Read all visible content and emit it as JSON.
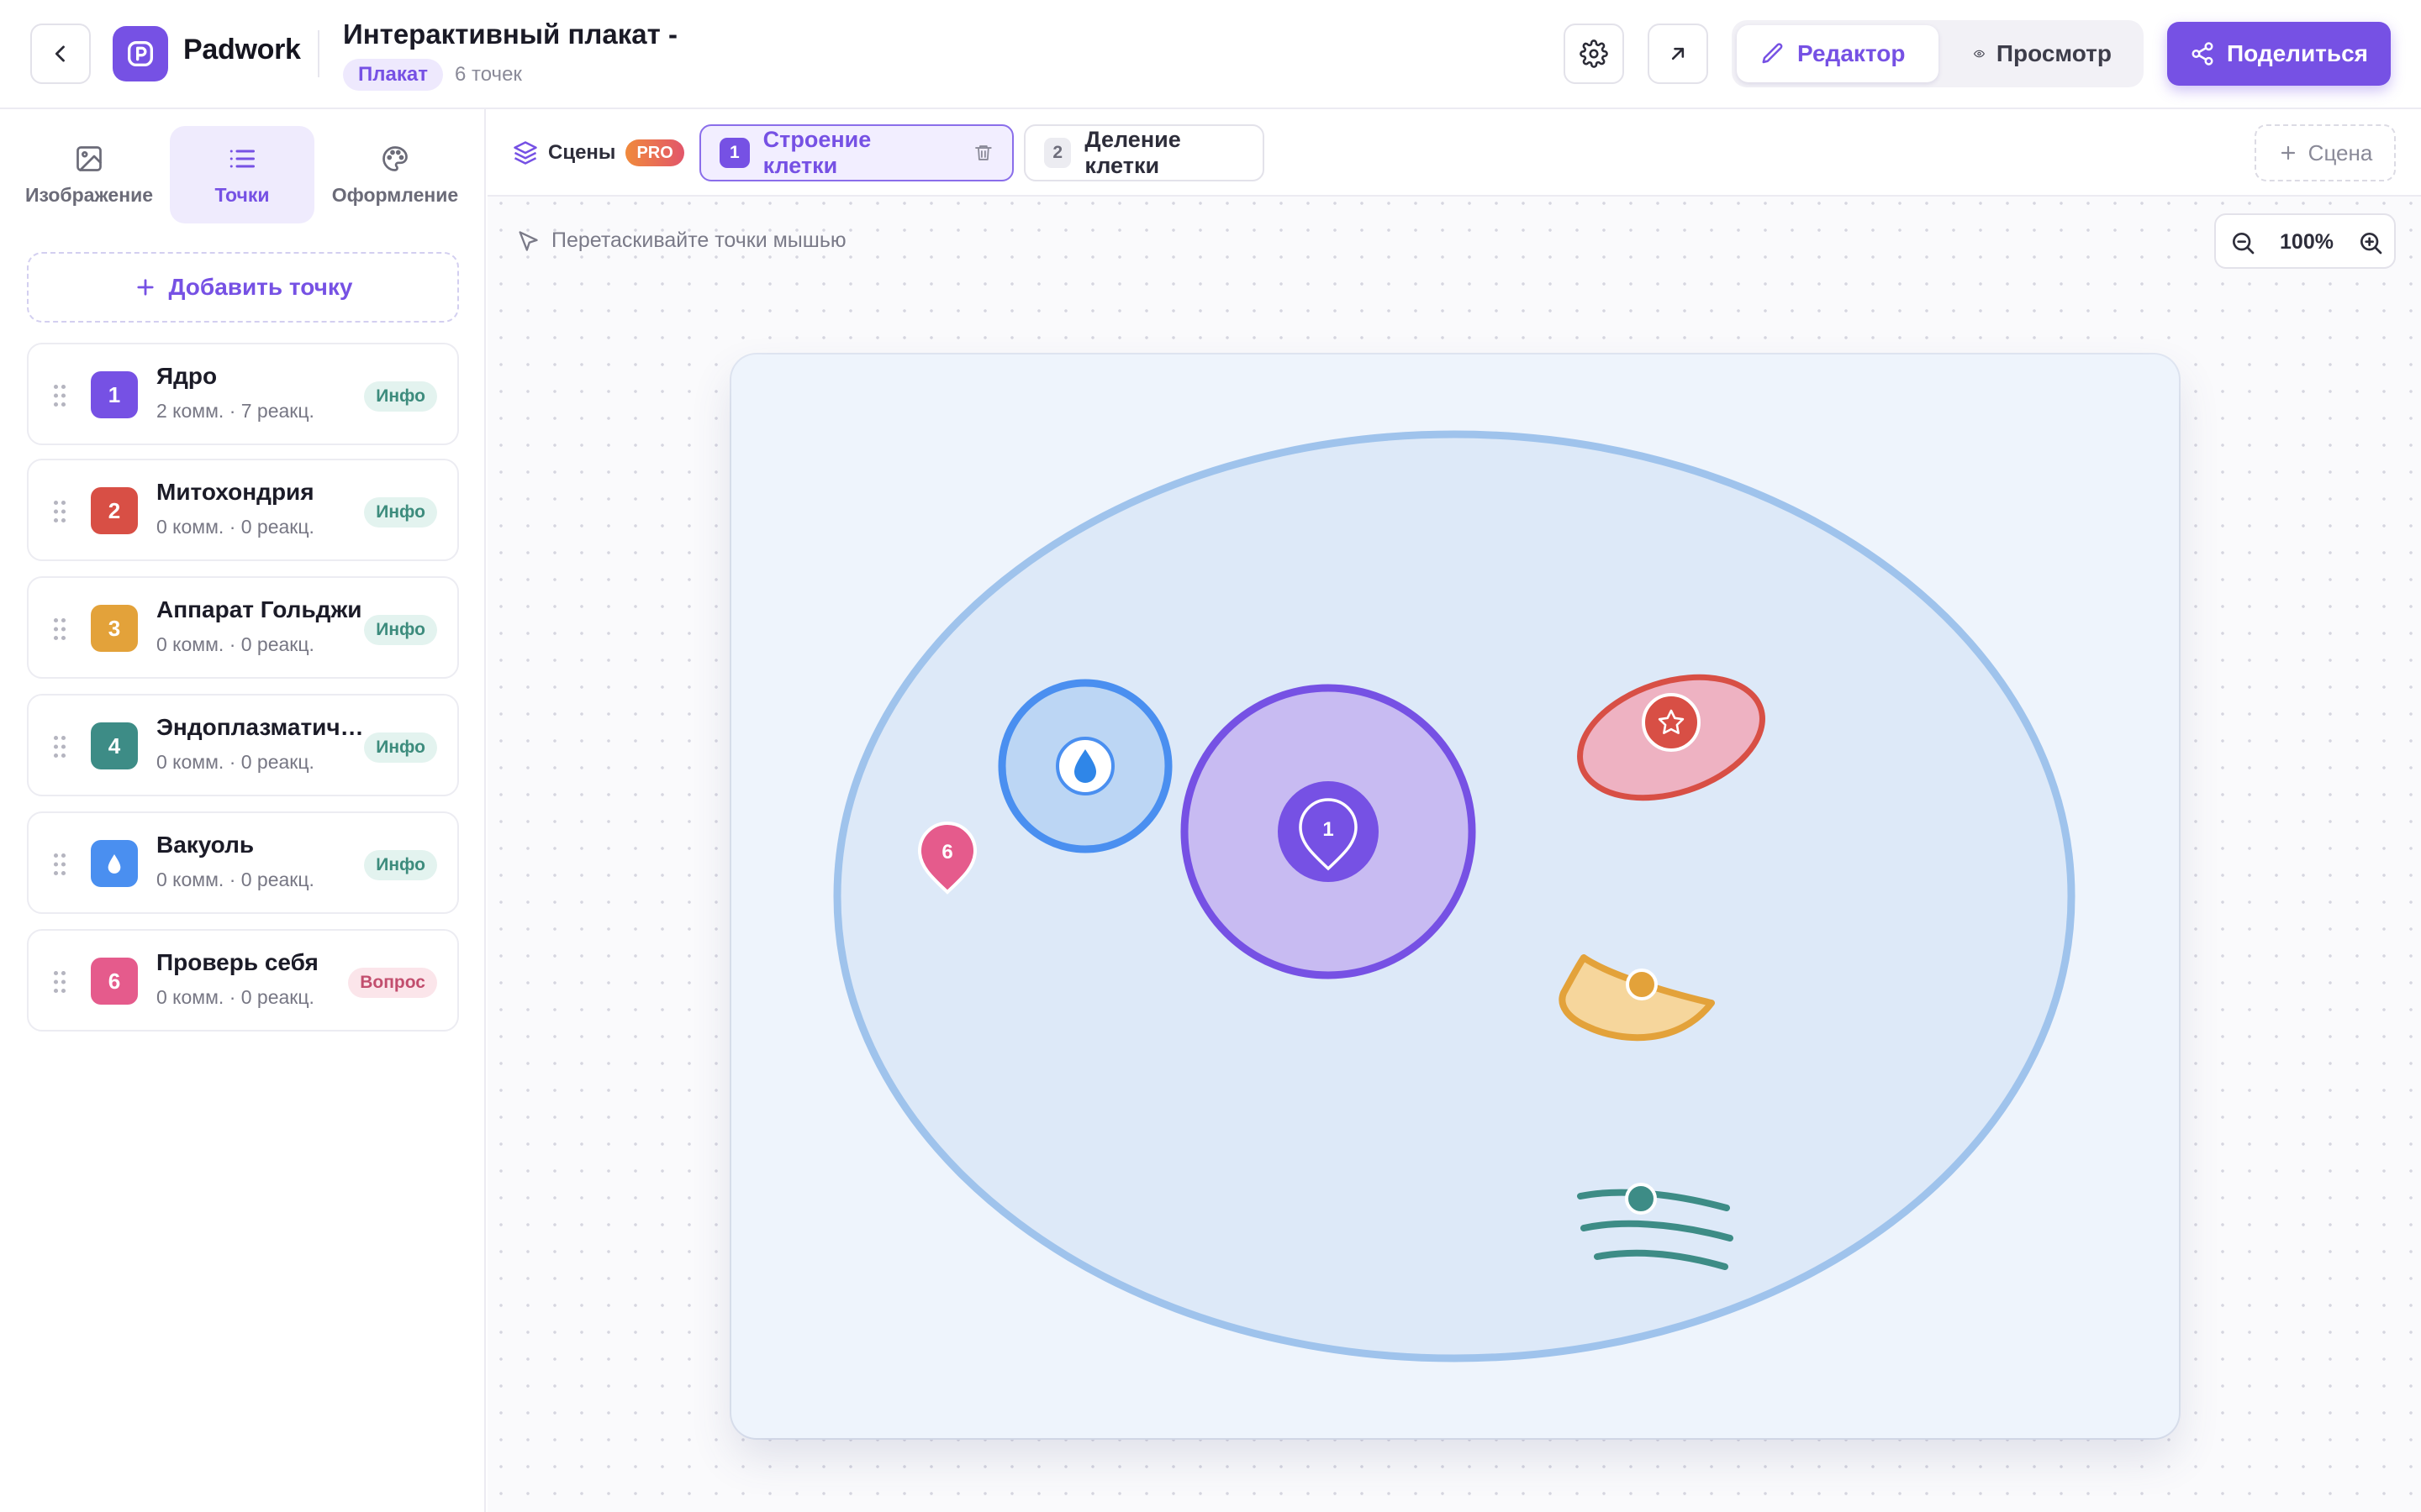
{
  "header": {
    "app_name": "Padwork",
    "doc_title": "Интерактивный плакат -",
    "doc_type": "Плакат",
    "doc_meta": "6 точек",
    "mode_editor": "Редактор",
    "mode_preview": "Просмотр",
    "share_label": "Поделиться"
  },
  "sidebar": {
    "tabs": [
      {
        "label": "Изображение",
        "icon": "image-icon",
        "active": false
      },
      {
        "label": "Точки",
        "icon": "list-icon",
        "active": true
      },
      {
        "label": "Оформление",
        "icon": "palette-icon",
        "active": false
      }
    ],
    "add_point_label": "Добавить точку",
    "points": [
      {
        "num": "1",
        "title": "Ядро",
        "stats": "2 комм. · 7 реакц.",
        "badge": "Инфо",
        "badge_type": "info",
        "color": "#7651e4"
      },
      {
        "num": "2",
        "title": "Митохондрия",
        "stats": "0 комм. · 0 реакц.",
        "badge": "Инфо",
        "badge_type": "info",
        "color": "#d84f45"
      },
      {
        "num": "3",
        "title": "Аппарат Гольджи",
        "stats": "0 комм. · 0 реакц.",
        "badge": "Инфо",
        "badge_type": "info",
        "color": "#e3a23a"
      },
      {
        "num": "4",
        "title": "Эндоплазматическая сеть",
        "stats": "0 комм. · 0 реакц.",
        "badge": "Инфо",
        "badge_type": "info",
        "color": "#3d8c86"
      },
      {
        "num": "",
        "icon": "droplet-icon",
        "title": "Вакуоль",
        "stats": "0 комм. · 0 реакц.",
        "badge": "Инфо",
        "badge_type": "info",
        "color": "#4a8ff0"
      },
      {
        "num": "6",
        "title": "Проверь себя",
        "stats": "0 комм. · 0 реакц.",
        "badge": "Вопрос",
        "badge_type": "q",
        "color": "#e55b8c"
      }
    ]
  },
  "scenes": {
    "label": "Сцены",
    "pro_badge": "PRO",
    "tabs": [
      {
        "num": "1",
        "label": "Строение клетки",
        "active": true
      },
      {
        "num": "2",
        "label": "Деление клетки",
        "active": false
      }
    ],
    "add_scene_label": "Сцена"
  },
  "canvas": {
    "drag_hint": "Перетаскивайте точки мышью",
    "zoom": "100%",
    "pin_nucleus": "1",
    "pin_question": "6"
  },
  "colors": {
    "accent": "#7651e4",
    "membrane": "#9fc3ec",
    "cytoplasm": "#dde9f8",
    "vacuole": "#4a8ff0",
    "mitochondria": "#d84f45",
    "golgi": "#e3a23a",
    "er": "#3d8c86",
    "question": "#e55b8c"
  }
}
